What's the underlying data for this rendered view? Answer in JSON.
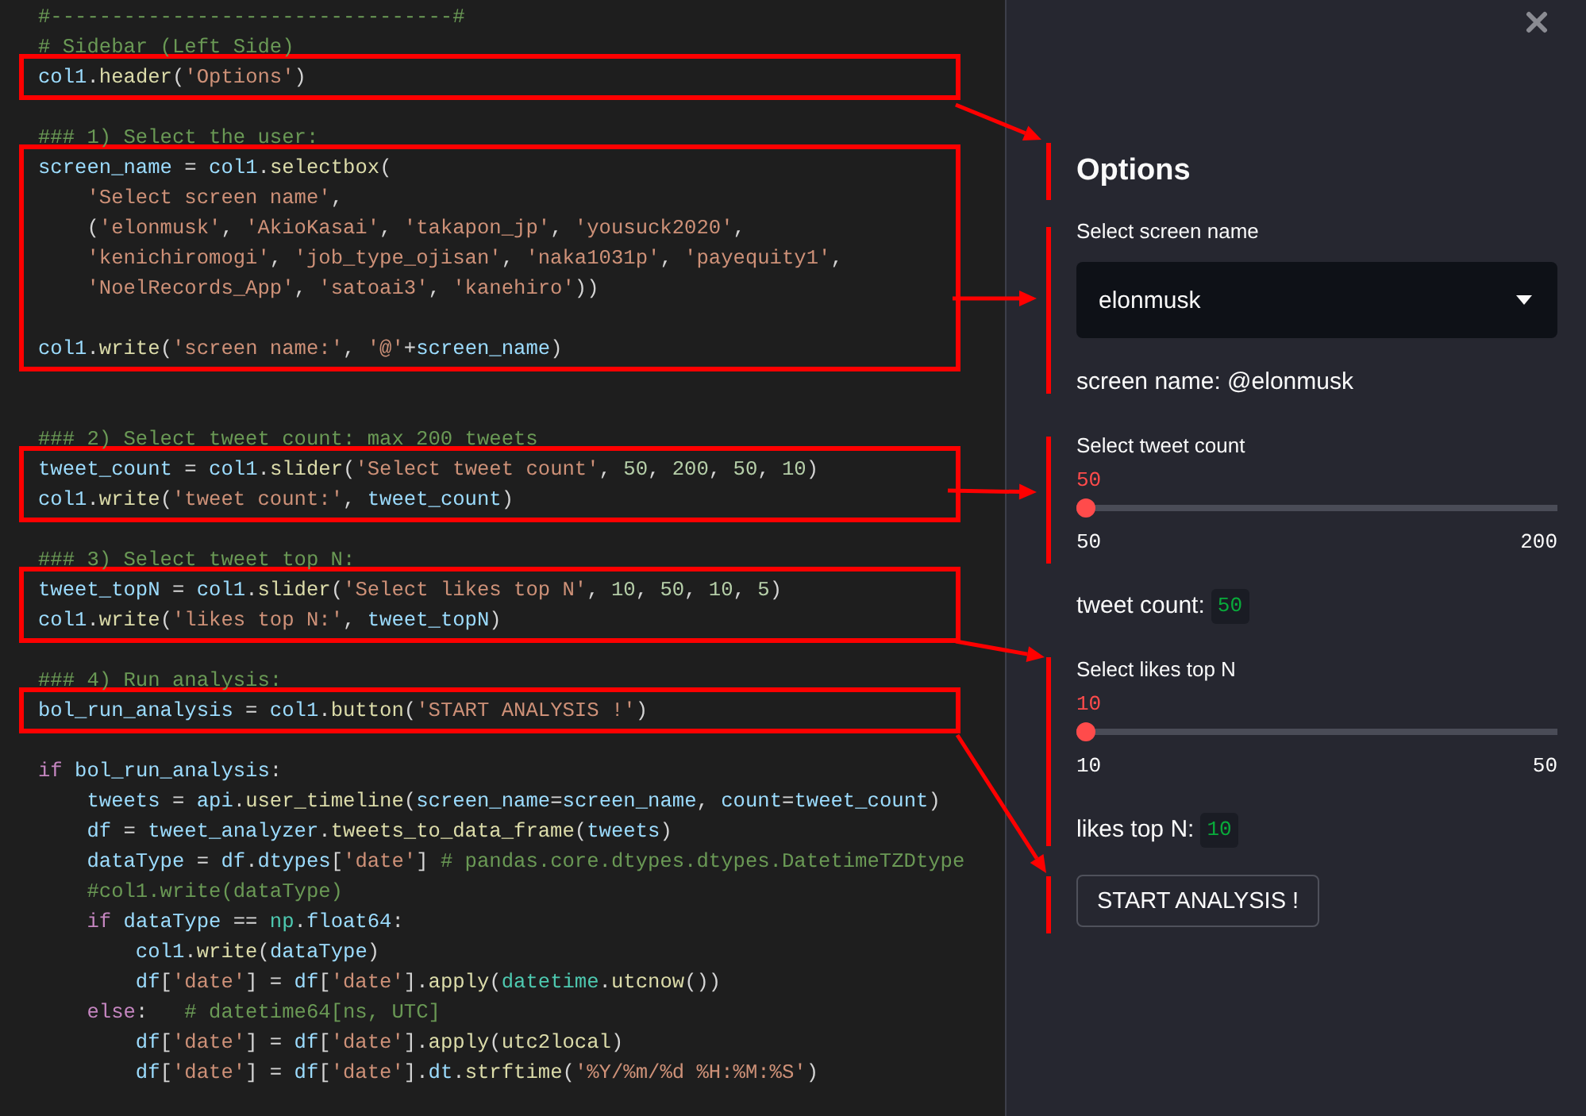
{
  "editor": {
    "blocks": [
      {
        "highlighted": false,
        "lines": [
          {
            "kind": "code",
            "tokens": [
              {
                "kind": "cm",
                "text": "#---------------------------------#"
              }
            ]
          },
          {
            "kind": "code",
            "tokens": [
              {
                "kind": "cm",
                "text": "# Sidebar (Left Side)"
              }
            ]
          }
        ]
      },
      {
        "highlighted": true,
        "lines": [
          {
            "kind": "code",
            "tokens": [
              {
                "kind": "var",
                "text": "col1"
              },
              {
                "kind": "pl",
                "text": "."
              },
              {
                "kind": "fn",
                "text": "header"
              },
              {
                "kind": "pl",
                "text": "("
              },
              {
                "kind": "str",
                "text": "'Options'"
              },
              {
                "kind": "pl",
                "text": ")"
              }
            ]
          }
        ]
      },
      {
        "highlighted": false,
        "lines": [
          {
            "kind": "blank"
          },
          {
            "kind": "code",
            "tokens": [
              {
                "kind": "cm",
                "text": "### 1) Select the user:"
              }
            ]
          }
        ]
      },
      {
        "highlighted": true,
        "lines": [
          {
            "kind": "code",
            "tokens": [
              {
                "kind": "var",
                "text": "screen_name"
              },
              {
                "kind": "pl",
                "text": " = "
              },
              {
                "kind": "var",
                "text": "col1"
              },
              {
                "kind": "pl",
                "text": "."
              },
              {
                "kind": "fn",
                "text": "selectbox"
              },
              {
                "kind": "pl",
                "text": "("
              }
            ]
          },
          {
            "kind": "code",
            "tokens": [
              {
                "kind": "str",
                "text": "    'Select screen name'"
              },
              {
                "kind": "pl",
                "text": ","
              }
            ]
          },
          {
            "kind": "code",
            "tokens": [
              {
                "kind": "pl",
                "text": "    ("
              },
              {
                "kind": "str",
                "text": "'elonmusk'"
              },
              {
                "kind": "pl",
                "text": ", "
              },
              {
                "kind": "str",
                "text": "'AkioKasai'"
              },
              {
                "kind": "pl",
                "text": ", "
              },
              {
                "kind": "str",
                "text": "'takapon_jp'"
              },
              {
                "kind": "pl",
                "text": ", "
              },
              {
                "kind": "str",
                "text": "'yousuck2020'"
              },
              {
                "kind": "pl",
                "text": ","
              }
            ]
          },
          {
            "kind": "code",
            "tokens": [
              {
                "kind": "str",
                "text": "    'kenichiromogi'"
              },
              {
                "kind": "pl",
                "text": ", "
              },
              {
                "kind": "str",
                "text": "'job_type_ojisan'"
              },
              {
                "kind": "pl",
                "text": ", "
              },
              {
                "kind": "str",
                "text": "'naka1031p'"
              },
              {
                "kind": "pl",
                "text": ", "
              },
              {
                "kind": "str",
                "text": "'payequity1'"
              },
              {
                "kind": "pl",
                "text": ","
              }
            ]
          },
          {
            "kind": "code",
            "tokens": [
              {
                "kind": "str",
                "text": "    'NoelRecords_App'"
              },
              {
                "kind": "pl",
                "text": ", "
              },
              {
                "kind": "str",
                "text": "'satoai3'"
              },
              {
                "kind": "pl",
                "text": ", "
              },
              {
                "kind": "str",
                "text": "'kanehiro'"
              },
              {
                "kind": "pl",
                "text": "))"
              }
            ]
          },
          {
            "kind": "blank"
          },
          {
            "kind": "code",
            "tokens": [
              {
                "kind": "var",
                "text": "col1"
              },
              {
                "kind": "pl",
                "text": "."
              },
              {
                "kind": "fn",
                "text": "write"
              },
              {
                "kind": "pl",
                "text": "("
              },
              {
                "kind": "str",
                "text": "'screen name:'"
              },
              {
                "kind": "pl",
                "text": ", "
              },
              {
                "kind": "str",
                "text": "'@'"
              },
              {
                "kind": "pl",
                "text": "+"
              },
              {
                "kind": "var",
                "text": "screen_name"
              },
              {
                "kind": "pl",
                "text": ")"
              }
            ]
          }
        ]
      },
      {
        "highlighted": false,
        "lines": [
          {
            "kind": "blank"
          },
          {
            "kind": "blank"
          },
          {
            "kind": "code",
            "tokens": [
              {
                "kind": "cm",
                "text": "### 2) Select tweet count: max 200 tweets"
              }
            ]
          }
        ]
      },
      {
        "highlighted": true,
        "lines": [
          {
            "kind": "code",
            "tokens": [
              {
                "kind": "var",
                "text": "tweet_count"
              },
              {
                "kind": "pl",
                "text": " = "
              },
              {
                "kind": "var",
                "text": "col1"
              },
              {
                "kind": "pl",
                "text": "."
              },
              {
                "kind": "fn",
                "text": "slider"
              },
              {
                "kind": "pl",
                "text": "("
              },
              {
                "kind": "str",
                "text": "'Select tweet count'"
              },
              {
                "kind": "pl",
                "text": ", "
              },
              {
                "kind": "num",
                "text": "50"
              },
              {
                "kind": "pl",
                "text": ", "
              },
              {
                "kind": "num",
                "text": "200"
              },
              {
                "kind": "pl",
                "text": ", "
              },
              {
                "kind": "num",
                "text": "50"
              },
              {
                "kind": "pl",
                "text": ", "
              },
              {
                "kind": "num",
                "text": "10"
              },
              {
                "kind": "pl",
                "text": ")"
              }
            ]
          },
          {
            "kind": "code",
            "tokens": [
              {
                "kind": "var",
                "text": "col1"
              },
              {
                "kind": "pl",
                "text": "."
              },
              {
                "kind": "fn",
                "text": "write"
              },
              {
                "kind": "pl",
                "text": "("
              },
              {
                "kind": "str",
                "text": "'tweet count:'"
              },
              {
                "kind": "pl",
                "text": ", "
              },
              {
                "kind": "var",
                "text": "tweet_count"
              },
              {
                "kind": "pl",
                "text": ")"
              }
            ]
          }
        ]
      },
      {
        "highlighted": false,
        "lines": [
          {
            "kind": "blank"
          },
          {
            "kind": "code",
            "tokens": [
              {
                "kind": "cm",
                "text": "### 3) Select tweet top N:"
              }
            ]
          }
        ]
      },
      {
        "highlighted": true,
        "lines": [
          {
            "kind": "code",
            "tokens": [
              {
                "kind": "var",
                "text": "tweet_topN"
              },
              {
                "kind": "pl",
                "text": " = "
              },
              {
                "kind": "var",
                "text": "col1"
              },
              {
                "kind": "pl",
                "text": "."
              },
              {
                "kind": "fn",
                "text": "slider"
              },
              {
                "kind": "pl",
                "text": "("
              },
              {
                "kind": "str",
                "text": "'Select likes top N'"
              },
              {
                "kind": "pl",
                "text": ", "
              },
              {
                "kind": "num",
                "text": "10"
              },
              {
                "kind": "pl",
                "text": ", "
              },
              {
                "kind": "num",
                "text": "50"
              },
              {
                "kind": "pl",
                "text": ", "
              },
              {
                "kind": "num",
                "text": "10"
              },
              {
                "kind": "pl",
                "text": ", "
              },
              {
                "kind": "num",
                "text": "5"
              },
              {
                "kind": "pl",
                "text": ")"
              }
            ]
          },
          {
            "kind": "code",
            "tokens": [
              {
                "kind": "var",
                "text": "col1"
              },
              {
                "kind": "pl",
                "text": "."
              },
              {
                "kind": "fn",
                "text": "write"
              },
              {
                "kind": "pl",
                "text": "("
              },
              {
                "kind": "str",
                "text": "'likes top N:'"
              },
              {
                "kind": "pl",
                "text": ", "
              },
              {
                "kind": "var",
                "text": "tweet_topN"
              },
              {
                "kind": "pl",
                "text": ")"
              }
            ]
          }
        ]
      },
      {
        "highlighted": false,
        "lines": [
          {
            "kind": "blank"
          },
          {
            "kind": "code",
            "tokens": [
              {
                "kind": "cm",
                "text": "### 4) Run analysis:"
              }
            ]
          }
        ]
      },
      {
        "highlighted": true,
        "lines": [
          {
            "kind": "code",
            "tokens": [
              {
                "kind": "var",
                "text": "bol_run_analysis"
              },
              {
                "kind": "pl",
                "text": " = "
              },
              {
                "kind": "var",
                "text": "col1"
              },
              {
                "kind": "pl",
                "text": "."
              },
              {
                "kind": "fn",
                "text": "button"
              },
              {
                "kind": "pl",
                "text": "("
              },
              {
                "kind": "str",
                "text": "'START ANALYSIS !'"
              },
              {
                "kind": "pl",
                "text": ")"
              }
            ]
          }
        ]
      },
      {
        "highlighted": false,
        "lines": [
          {
            "kind": "blank"
          },
          {
            "kind": "code",
            "tokens": [
              {
                "kind": "kw",
                "text": "if "
              },
              {
                "kind": "var",
                "text": "bol_run_analysis"
              },
              {
                "kind": "pl",
                "text": ":"
              }
            ]
          },
          {
            "kind": "code",
            "tokens": [
              {
                "kind": "var",
                "text": "    tweets"
              },
              {
                "kind": "pl",
                "text": " = "
              },
              {
                "kind": "var",
                "text": "api"
              },
              {
                "kind": "pl",
                "text": "."
              },
              {
                "kind": "fn",
                "text": "user_timeline"
              },
              {
                "kind": "pl",
                "text": "("
              },
              {
                "kind": "var",
                "text": "screen_name"
              },
              {
                "kind": "pl",
                "text": "="
              },
              {
                "kind": "var",
                "text": "screen_name"
              },
              {
                "kind": "pl",
                "text": ", "
              },
              {
                "kind": "var",
                "text": "count"
              },
              {
                "kind": "pl",
                "text": "="
              },
              {
                "kind": "var",
                "text": "tweet_count"
              },
              {
                "kind": "pl",
                "text": ")"
              }
            ]
          },
          {
            "kind": "code",
            "tokens": [
              {
                "kind": "var",
                "text": "    df"
              },
              {
                "kind": "pl",
                "text": " = "
              },
              {
                "kind": "var",
                "text": "tweet_analyzer"
              },
              {
                "kind": "pl",
                "text": "."
              },
              {
                "kind": "fn",
                "text": "tweets_to_data_frame"
              },
              {
                "kind": "pl",
                "text": "("
              },
              {
                "kind": "var",
                "text": "tweets"
              },
              {
                "kind": "pl",
                "text": ")"
              }
            ]
          },
          {
            "kind": "code",
            "tokens": [
              {
                "kind": "var",
                "text": "    dataType"
              },
              {
                "kind": "pl",
                "text": " = "
              },
              {
                "kind": "var",
                "text": "df"
              },
              {
                "kind": "pl",
                "text": "."
              },
              {
                "kind": "var",
                "text": "dtypes"
              },
              {
                "kind": "pl",
                "text": "["
              },
              {
                "kind": "str",
                "text": "'date'"
              },
              {
                "kind": "pl",
                "text": "] "
              },
              {
                "kind": "cm",
                "text": "# pandas.core.dtypes.dtypes.DatetimeTZDtype"
              }
            ]
          },
          {
            "kind": "code",
            "tokens": [
              {
                "kind": "cm",
                "text": "    #col1.write(dataType)"
              }
            ]
          },
          {
            "kind": "code",
            "tokens": [
              {
                "kind": "kw",
                "text": "    if "
              },
              {
                "kind": "var",
                "text": "dataType"
              },
              {
                "kind": "pl",
                "text": " == "
              },
              {
                "kind": "cls",
                "text": "np"
              },
              {
                "kind": "pl",
                "text": "."
              },
              {
                "kind": "var",
                "text": "float64"
              },
              {
                "kind": "pl",
                "text": ":"
              }
            ]
          },
          {
            "kind": "code",
            "tokens": [
              {
                "kind": "var",
                "text": "        col1"
              },
              {
                "kind": "pl",
                "text": "."
              },
              {
                "kind": "fn",
                "text": "write"
              },
              {
                "kind": "pl",
                "text": "("
              },
              {
                "kind": "var",
                "text": "dataType"
              },
              {
                "kind": "pl",
                "text": ")"
              }
            ]
          },
          {
            "kind": "code",
            "tokens": [
              {
                "kind": "var",
                "text": "        df"
              },
              {
                "kind": "pl",
                "text": "["
              },
              {
                "kind": "str",
                "text": "'date'"
              },
              {
                "kind": "pl",
                "text": "] = "
              },
              {
                "kind": "var",
                "text": "df"
              },
              {
                "kind": "pl",
                "text": "["
              },
              {
                "kind": "str",
                "text": "'date'"
              },
              {
                "kind": "pl",
                "text": "]."
              },
              {
                "kind": "fn",
                "text": "apply"
              },
              {
                "kind": "pl",
                "text": "("
              },
              {
                "kind": "cls",
                "text": "datetime"
              },
              {
                "kind": "pl",
                "text": "."
              },
              {
                "kind": "fn",
                "text": "utcnow"
              },
              {
                "kind": "pl",
                "text": "())"
              }
            ]
          },
          {
            "kind": "code",
            "tokens": [
              {
                "kind": "kw",
                "text": "    else"
              },
              {
                "kind": "pl",
                "text": ":   "
              },
              {
                "kind": "cm",
                "text": "# datetime64[ns, UTC]"
              }
            ]
          },
          {
            "kind": "code",
            "tokens": [
              {
                "kind": "var",
                "text": "        df"
              },
              {
                "kind": "pl",
                "text": "["
              },
              {
                "kind": "str",
                "text": "'date'"
              },
              {
                "kind": "pl",
                "text": "] = "
              },
              {
                "kind": "var",
                "text": "df"
              },
              {
                "kind": "pl",
                "text": "["
              },
              {
                "kind": "str",
                "text": "'date'"
              },
              {
                "kind": "pl",
                "text": "]."
              },
              {
                "kind": "fn",
                "text": "apply"
              },
              {
                "kind": "pl",
                "text": "("
              },
              {
                "kind": "fn",
                "text": "utc2local"
              },
              {
                "kind": "pl",
                "text": ")"
              }
            ]
          },
          {
            "kind": "code",
            "tokens": [
              {
                "kind": "var",
                "text": "        df"
              },
              {
                "kind": "pl",
                "text": "["
              },
              {
                "kind": "str",
                "text": "'date'"
              },
              {
                "kind": "pl",
                "text": "] = "
              },
              {
                "kind": "var",
                "text": "df"
              },
              {
                "kind": "pl",
                "text": "["
              },
              {
                "kind": "str",
                "text": "'date'"
              },
              {
                "kind": "pl",
                "text": "]."
              },
              {
                "kind": "var",
                "text": "dt"
              },
              {
                "kind": "pl",
                "text": "."
              },
              {
                "kind": "fn",
                "text": "strftime"
              },
              {
                "kind": "pl",
                "text": "("
              },
              {
                "kind": "str",
                "text": "'%Y/%m/%d %H:%M:%S'"
              },
              {
                "kind": "pl",
                "text": ")"
              }
            ]
          }
        ]
      }
    ]
  },
  "sidebar": {
    "widgets": [
      {
        "kind": "header",
        "text": "Options"
      },
      {
        "kind": "select",
        "label": "Select screen name",
        "value": "elonmusk"
      },
      {
        "kind": "text",
        "text": "screen name: @elonmusk"
      },
      {
        "kind": "slider",
        "label": "Select tweet count",
        "value": "50",
        "min": "50",
        "max": "200",
        "level": 0
      },
      {
        "kind": "text_code",
        "text": "tweet count:",
        "code": "50"
      },
      {
        "kind": "slider",
        "label": "Select likes top N",
        "value": "10",
        "min": "10",
        "max": "50",
        "level": 0
      },
      {
        "kind": "text_code",
        "text": "likes top N:",
        "code": "10"
      },
      {
        "kind": "button",
        "text": "START ANALYSIS !"
      }
    ]
  }
}
